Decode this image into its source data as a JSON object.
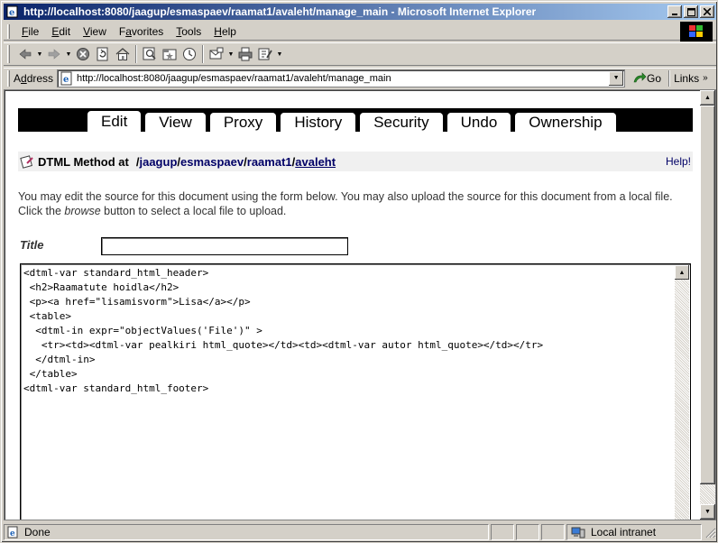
{
  "window": {
    "title": "http://localhost:8080/jaagup/esmaspaev/raamat1/avaleht/manage_main - Microsoft Internet Explorer",
    "minimize": "_",
    "maximize": "□",
    "close": "×"
  },
  "menubar": {
    "items": [
      {
        "accel": "F",
        "rest": "ile"
      },
      {
        "accel": "E",
        "rest": "dit"
      },
      {
        "accel": "V",
        "rest": "iew"
      },
      {
        "pre": "F",
        "accel": "a",
        "rest": "vorites"
      },
      {
        "accel": "T",
        "rest": "ools"
      },
      {
        "accel": "H",
        "rest": "elp"
      }
    ]
  },
  "addressbar": {
    "label_accel": "d",
    "label_pre": "A",
    "label_rest": "dress",
    "url": "http://localhost:8080/jaagup/esmaspaev/raamat1/avaleht/manage_main",
    "go_label": "Go",
    "links_label": "Links"
  },
  "tabs": [
    "Edit",
    "View",
    "Proxy",
    "History",
    "Security",
    "Undo",
    "Ownership"
  ],
  "location": {
    "type": "DTML Method at",
    "path": [
      "jaagup",
      "esmaspaev",
      "raamat1"
    ],
    "current": "avaleht",
    "help": "Help!"
  },
  "description": {
    "part1": "You may edit the source for this document using the form below. You may also upload the source for this document from a local file. Click the ",
    "emph": "browse",
    "part2": " button to select a local file to upload."
  },
  "form": {
    "title_label": "Title",
    "title_value": "",
    "source": "<dtml-var standard_html_header>\n <h2>Raamatute hoidla</h2>\n <p><a href=\"lisamisvorm\">Lisa</a></p>\n <table>\n  <dtml-in expr=\"objectValues('File')\" >\n   <tr><td><dtml-var pealkiri html_quote></td><td><dtml-var autor html_quote></td></tr>\n  </dtml-in>\n </table>\n<dtml-var standard_html_footer>"
  },
  "statusbar": {
    "text": "Done",
    "zone": "Local intranet"
  },
  "colors": {
    "titlebar_start": "#0a246a",
    "titlebar_end": "#a6caf0",
    "link": "#000066",
    "tabs_bg": "#000000"
  }
}
